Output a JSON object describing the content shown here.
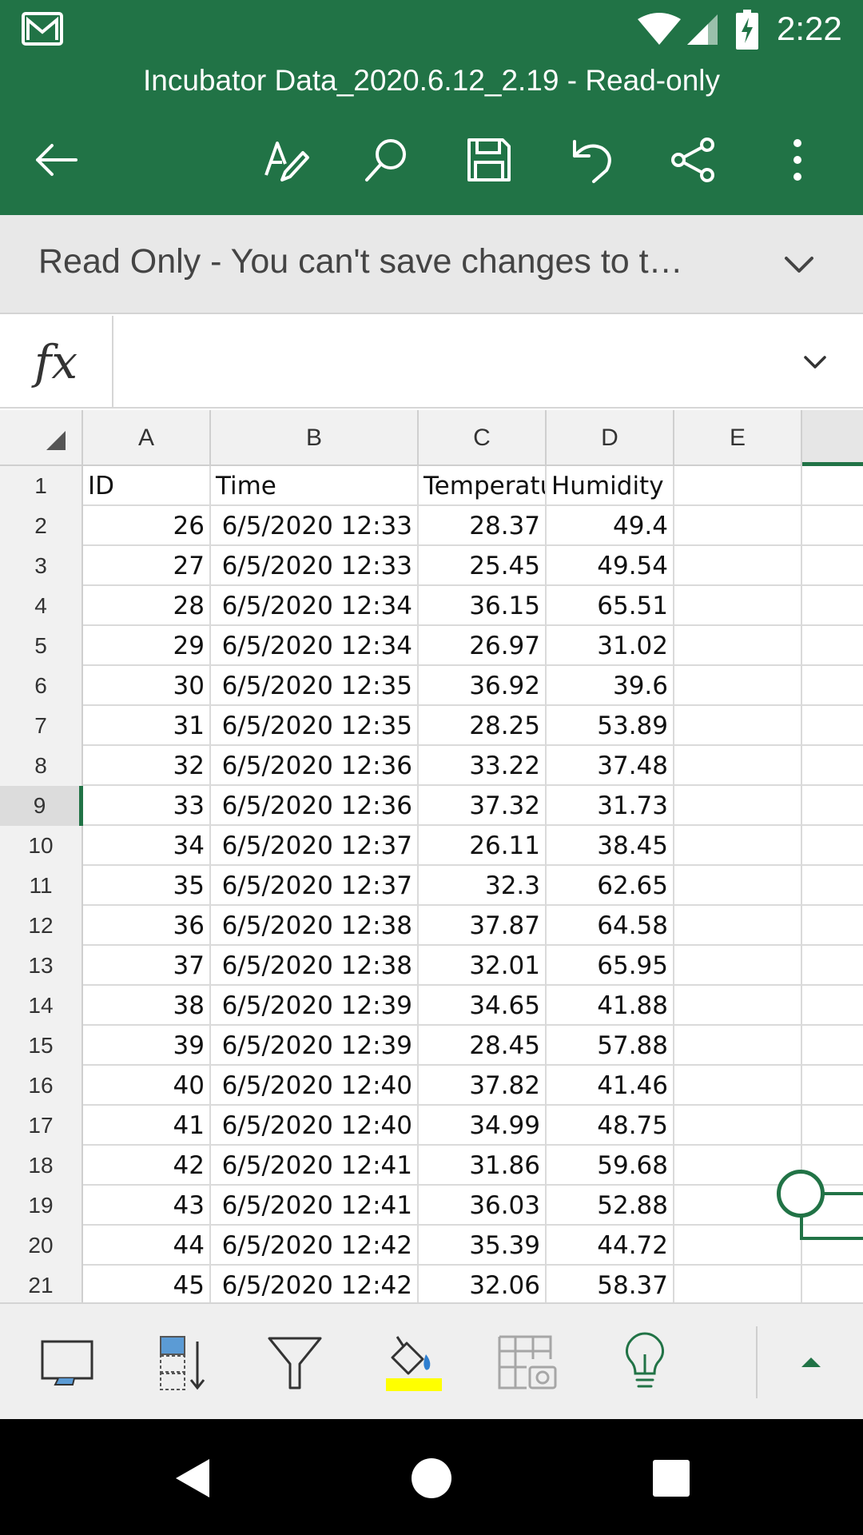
{
  "status_bar": {
    "time": "2:22",
    "icons": [
      "gmail-icon",
      "wifi-icon",
      "cell-signal-icon",
      "battery-charging-icon"
    ]
  },
  "title_bar": {
    "document_title": "Incubator Data_2020.6.12_2.19 - Read-only"
  },
  "toolbar": {
    "icons": [
      "back-arrow-icon",
      "draw-pen-icon",
      "search-icon",
      "save-icon",
      "undo-icon",
      "share-icon",
      "more-vertical-icon"
    ]
  },
  "banner": {
    "text": "Read Only - You can't save changes to t…",
    "icon": "chevron-down-icon"
  },
  "formula_bar": {
    "label": "fx",
    "value": ""
  },
  "sheet": {
    "column_headers": [
      "A",
      "B",
      "C",
      "D",
      "E"
    ],
    "header_row": {
      "row": "1",
      "cells": [
        "ID",
        "Time",
        "Temperatu",
        "Humidity",
        ""
      ]
    },
    "rows": [
      {
        "row": "2",
        "cells": [
          "26",
          "6/5/2020 12:33",
          "28.37",
          "49.4"
        ]
      },
      {
        "row": "3",
        "cells": [
          "27",
          "6/5/2020 12:33",
          "25.45",
          "49.54"
        ]
      },
      {
        "row": "4",
        "cells": [
          "28",
          "6/5/2020 12:34",
          "36.15",
          "65.51"
        ]
      },
      {
        "row": "5",
        "cells": [
          "29",
          "6/5/2020 12:34",
          "26.97",
          "31.02"
        ]
      },
      {
        "row": "6",
        "cells": [
          "30",
          "6/5/2020 12:35",
          "36.92",
          "39.6"
        ]
      },
      {
        "row": "7",
        "cells": [
          "31",
          "6/5/2020 12:35",
          "28.25",
          "53.89"
        ]
      },
      {
        "row": "8",
        "cells": [
          "32",
          "6/5/2020 12:36",
          "33.22",
          "37.48"
        ]
      },
      {
        "row": "9",
        "cells": [
          "33",
          "6/5/2020 12:36",
          "37.32",
          "31.73"
        ]
      },
      {
        "row": "10",
        "cells": [
          "34",
          "6/5/2020 12:37",
          "26.11",
          "38.45"
        ]
      },
      {
        "row": "11",
        "cells": [
          "35",
          "6/5/2020 12:37",
          "32.3",
          "62.65"
        ]
      },
      {
        "row": "12",
        "cells": [
          "36",
          "6/5/2020 12:38",
          "37.87",
          "64.58"
        ]
      },
      {
        "row": "13",
        "cells": [
          "37",
          "6/5/2020 12:38",
          "32.01",
          "65.95"
        ]
      },
      {
        "row": "14",
        "cells": [
          "38",
          "6/5/2020 12:39",
          "34.65",
          "41.88"
        ]
      },
      {
        "row": "15",
        "cells": [
          "39",
          "6/5/2020 12:39",
          "28.45",
          "57.88"
        ]
      },
      {
        "row": "16",
        "cells": [
          "40",
          "6/5/2020 12:40",
          "37.82",
          "41.46"
        ]
      },
      {
        "row": "17",
        "cells": [
          "41",
          "6/5/2020 12:40",
          "34.99",
          "48.75"
        ]
      },
      {
        "row": "18",
        "cells": [
          "42",
          "6/5/2020 12:41",
          "31.86",
          "59.68"
        ]
      },
      {
        "row": "19",
        "cells": [
          "43",
          "6/5/2020 12:41",
          "36.03",
          "52.88"
        ]
      },
      {
        "row": "20",
        "cells": [
          "44",
          "6/5/2020 12:42",
          "35.39",
          "44.72"
        ]
      },
      {
        "row": "21",
        "cells": [
          "45",
          "6/5/2020 12:42",
          "32.06",
          "58.37"
        ]
      }
    ],
    "active_row": "9"
  },
  "bottom_toolbar": {
    "icons": [
      "keyboard-icon",
      "sort-icon",
      "filter-icon",
      "fill-color-icon",
      "table-camera-icon",
      "lightbulb-icon",
      "expand-up-icon"
    ],
    "fill_color": "#ffff00"
  },
  "nav_bar": {
    "icons": [
      "back-triangle-icon",
      "home-circle-icon",
      "recents-square-icon"
    ]
  },
  "colors": {
    "brand": "#217346",
    "banner_bg": "#e8e8e8",
    "header_bg": "#f1f1f1"
  }
}
